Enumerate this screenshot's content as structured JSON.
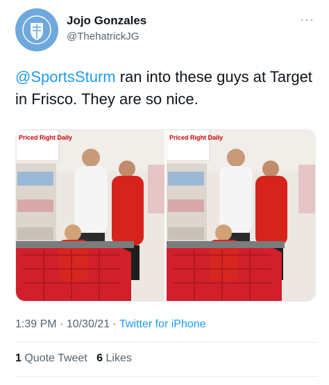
{
  "author": {
    "name": "Jojo Gonzales",
    "handle": "@ThehatrickJG"
  },
  "tweet": {
    "mention": "@SportsSturm",
    "text": " ran into these guys at Target in Frisco. They are so nice."
  },
  "photo": {
    "sign_text": "Priced Right Daily"
  },
  "meta": {
    "time": "1:39 PM",
    "date": "10/30/21",
    "separator": " · ",
    "source": "Twitter for iPhone"
  },
  "stats": {
    "quote_count": "1",
    "quote_label": "Quote Tweet",
    "like_count": "6",
    "like_label": "Likes"
  },
  "colors": {
    "accent": "#1d9bf0",
    "text": "#0f1419",
    "muted": "#536471"
  }
}
